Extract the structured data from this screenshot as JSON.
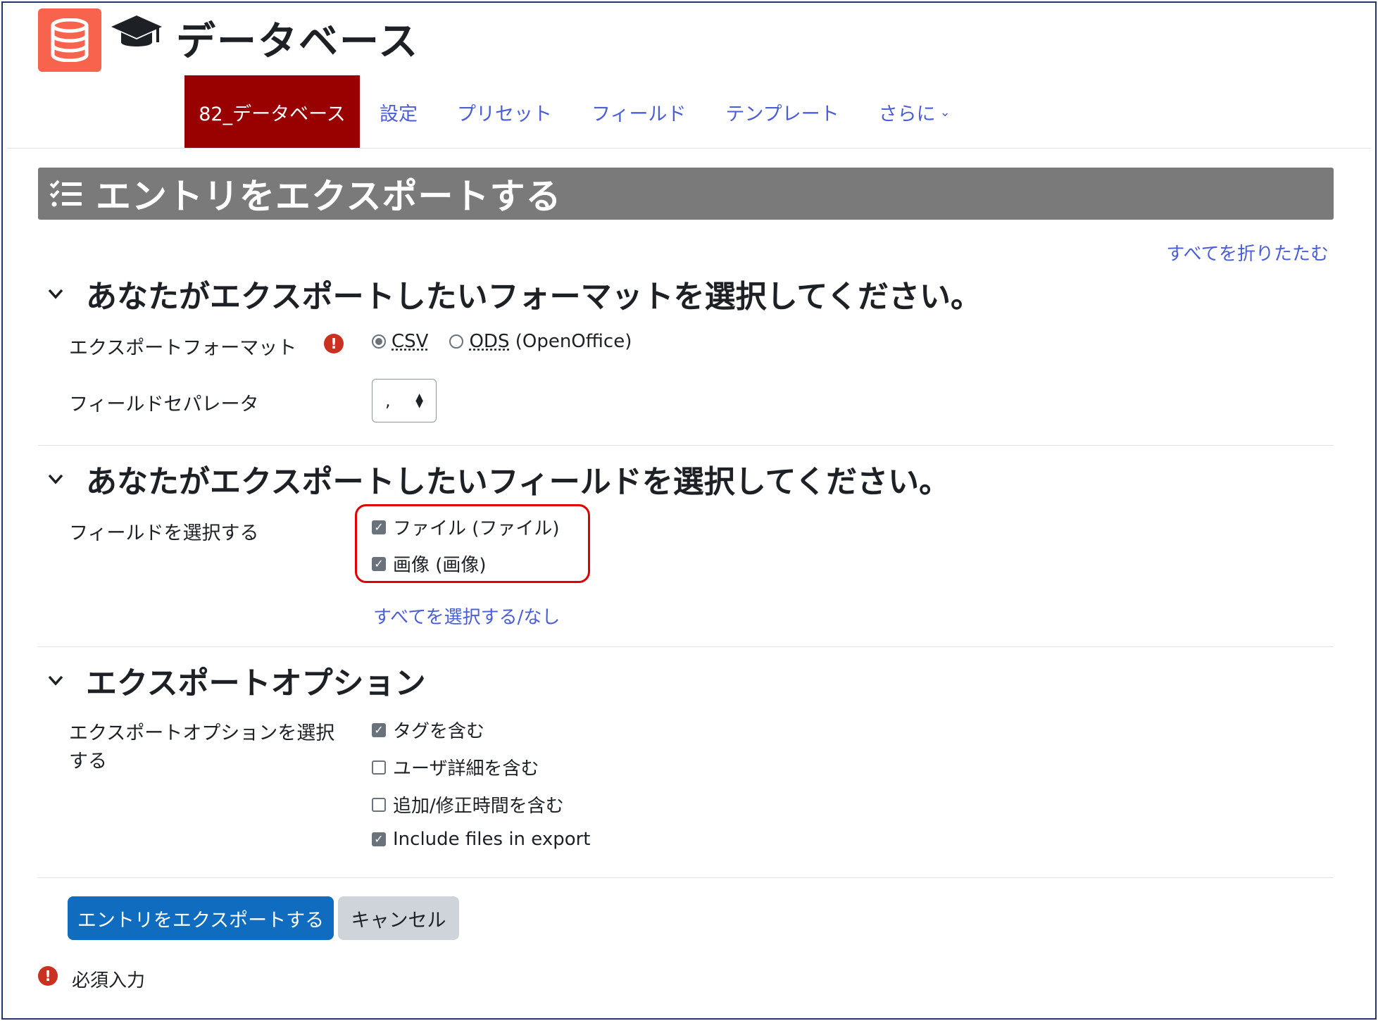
{
  "header": {
    "app_title": "データベース",
    "app_icon": "database-icon",
    "course_icon": "graduation-cap-icon",
    "accent": "#f7634d"
  },
  "nav": {
    "tabs": [
      {
        "label": "82_データベース",
        "active": true
      },
      {
        "label": "設定"
      },
      {
        "label": "プリセット"
      },
      {
        "label": "フィールド"
      },
      {
        "label": "テンプレート"
      },
      {
        "label": "さらに"
      }
    ],
    "active_color": "#990000",
    "link_color": "#4b5ed8"
  },
  "page": {
    "heading": "エントリをエクスポートする",
    "heading_icon": "checklist-icon",
    "collapse_all": "すべてを折りたたむ"
  },
  "format_section": {
    "title": "あなたがエクスポートしたいフォーマットを選択してください。",
    "format_label": "エクスポートフォーマット",
    "required_icon": "!",
    "options": [
      {
        "label": "CSV",
        "selected": true
      },
      {
        "label": "ODS",
        "suffix": " (OpenOffice)",
        "selected": false
      }
    ],
    "separator_label": "フィールドセパレータ",
    "separator_value": ","
  },
  "fields_section": {
    "title": "あなたがエクスポートしたいフィールドを選択してください。",
    "label": "フィールドを選択する",
    "fields": [
      {
        "label": "ファイル (ファイル)",
        "checked": true
      },
      {
        "label": "画像 (画像)",
        "checked": true
      }
    ],
    "select_all": "すべてを選択する/なし",
    "highlight_color": "#e00000"
  },
  "options_section": {
    "title": "エクスポートオプション",
    "label": "エクスポートオプションを選択する",
    "options": [
      {
        "label": "タグを含む",
        "checked": true
      },
      {
        "label": "ユーザ詳細を含む",
        "checked": false
      },
      {
        "label": "追加/修正時間を含む",
        "checked": false
      },
      {
        "label": "Include files in export",
        "checked": true
      }
    ]
  },
  "actions": {
    "submit": "エントリをエクスポートする",
    "cancel": "キャンセル",
    "primary_color": "#0f6cbf"
  },
  "footer": {
    "required_note": "必須入力"
  }
}
